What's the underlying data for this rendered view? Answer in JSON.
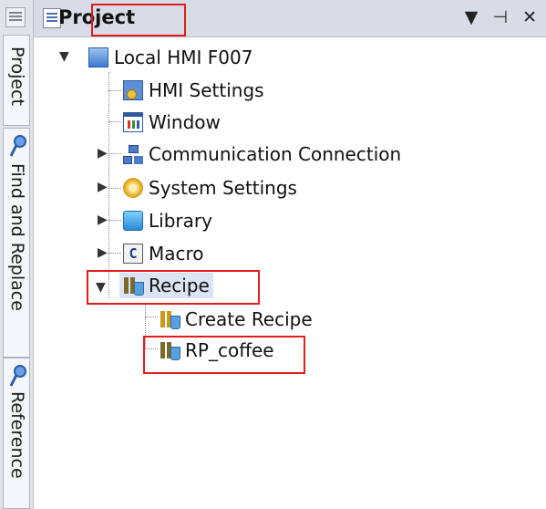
{
  "sidebar": {
    "tabs": [
      {
        "label": "Project"
      },
      {
        "label": "Find and Replace"
      },
      {
        "label": "Reference"
      }
    ]
  },
  "panel": {
    "title": "Project",
    "buttons": {
      "dropdown": "▼",
      "pin": "⊣",
      "close": "✕"
    }
  },
  "tree": {
    "root": "Local HMI F007",
    "items": [
      {
        "label": "HMI Settings",
        "icon": "hmi-settings-icon"
      },
      {
        "label": "Window",
        "icon": "window-icon"
      },
      {
        "label": "Communication Connection",
        "icon": "network-icon"
      },
      {
        "label": "System Settings",
        "icon": "gear-icon"
      },
      {
        "label": "Library",
        "icon": "library-icon"
      },
      {
        "label": "Macro",
        "icon": "macro-icon"
      },
      {
        "label": "Recipe",
        "icon": "recipe-icon"
      }
    ],
    "recipe_children": [
      {
        "label": "Create Recipe",
        "icon": "create-recipe-icon"
      },
      {
        "label": "RP_coffee",
        "icon": "recipe-icon"
      }
    ]
  },
  "colors": {
    "highlight": "#e21b1b",
    "selection": "#dbe4f3"
  }
}
